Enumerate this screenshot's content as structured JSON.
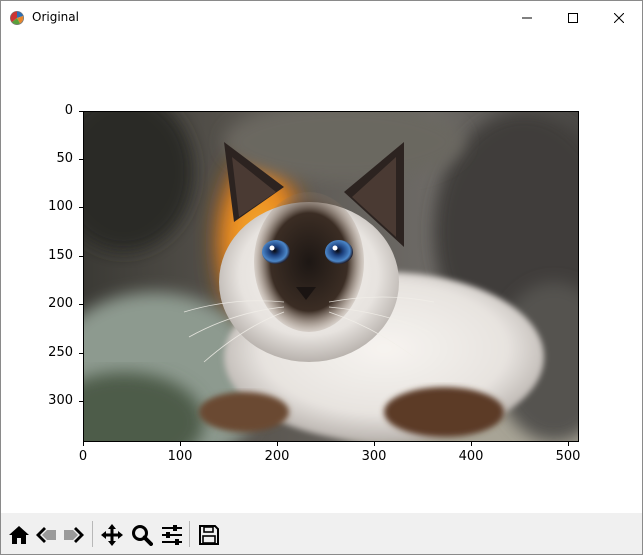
{
  "window": {
    "title": "Original"
  },
  "axes": {
    "x_ticks": [
      "0",
      "100",
      "200",
      "300",
      "400",
      "500"
    ],
    "y_ticks": [
      "0",
      "50",
      "100",
      "150",
      "200",
      "250",
      "300"
    ]
  },
  "image": {
    "subject": "siamese-kitten-photo"
  },
  "toolbar": {
    "buttons": [
      "home-icon",
      "back-icon",
      "forward-icon",
      "pan-icon",
      "zoom-icon",
      "configure-subplots-icon",
      "save-icon"
    ]
  }
}
